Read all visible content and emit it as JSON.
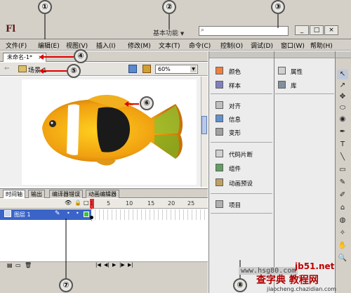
{
  "app": {
    "logo": "Fl",
    "workspace": "基本功能",
    "workspace_arrow": "▼"
  },
  "window_buttons": [
    "_",
    "□",
    "×"
  ],
  "menu": [
    "文件(F)",
    "编辑(E)",
    "视图(V)",
    "插入(I)",
    "修改(M)",
    "文本(T)",
    "命令(C)",
    "控制(O)",
    "调试(D)",
    "窗口(W)",
    "帮助(H)"
  ],
  "document_tab": {
    "label": "未命名-1*",
    "close": "×"
  },
  "scene": {
    "label": "场景 1",
    "back": "⇐"
  },
  "zoom": {
    "value": "60%",
    "dropdown": "▼"
  },
  "timeline_tabs": [
    "时间轴",
    "输出",
    "编译器错误",
    "动画编辑器"
  ],
  "timeline": {
    "ruler": [
      "1",
      "5",
      "10",
      "15",
      "20",
      "25"
    ],
    "layer_name": "图层 1",
    "header_icons": [
      "👁",
      "🔒",
      "□"
    ],
    "bottom_controls": [
      "|◀",
      "◀|",
      "▶",
      "|▶",
      "▶|"
    ]
  },
  "panels_col1": {
    "group1": [
      "颜色",
      "样本"
    ],
    "group2": [
      "对齐",
      "信息",
      "变形"
    ],
    "group3": [
      "代码片断",
      "组件",
      "动画预设"
    ],
    "group4": [
      "项目"
    ]
  },
  "panels_col2": [
    "属性",
    "库"
  ],
  "tools": [
    "↖",
    "↗",
    "✥",
    "⬭",
    "◉",
    "✒",
    "T",
    "╲",
    "▭",
    "✎",
    "✐",
    "⌂",
    "◍",
    "✧",
    "✋",
    "🔍"
  ],
  "annotations": [
    "①",
    "②",
    "③",
    "④",
    "⑤",
    "⑥",
    "⑦",
    "⑧"
  ],
  "watermarks": {
    "site1": "www.hsg80.com",
    "site2": "jb51.net",
    "site3": "查字典 教程网",
    "site4": "jiaocheng.chazidian.com"
  }
}
